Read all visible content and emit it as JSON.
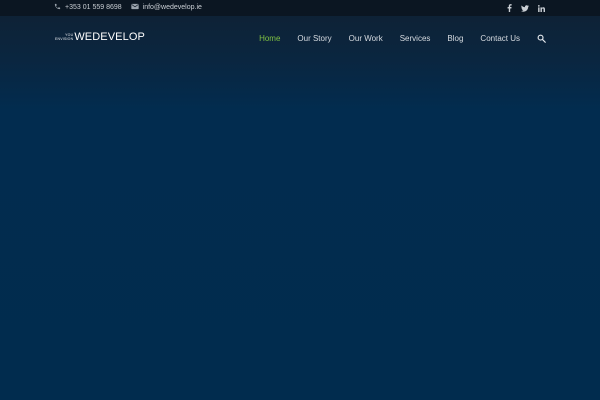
{
  "topbar": {
    "phone": "+353 01 559 8698",
    "email": "info@wedevelop.ie",
    "social": [
      "facebook-icon",
      "twitter-icon",
      "linkedin-icon"
    ]
  },
  "logo": {
    "small_line1": "YOU",
    "small_line2": "ENVISION",
    "main": "WEDEVELOP"
  },
  "nav": {
    "items": [
      {
        "label": "Home",
        "active": true
      },
      {
        "label": "Our Story",
        "active": false
      },
      {
        "label": "Our Work",
        "active": false
      },
      {
        "label": "Services",
        "active": false
      },
      {
        "label": "Blog",
        "active": false
      },
      {
        "label": "Contact Us",
        "active": false
      }
    ],
    "search_icon": "search-icon"
  },
  "colors": {
    "accent": "#7fc143",
    "background": "#012c4e",
    "topbar": "#0b1622"
  }
}
